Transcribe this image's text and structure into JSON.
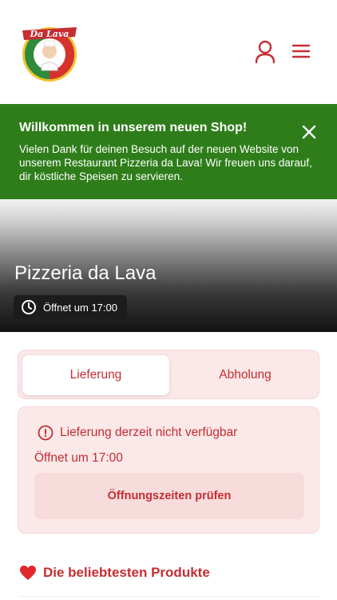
{
  "header": {
    "logo_text": "Da Lava",
    "user_icon": "user-icon",
    "menu_icon": "menu-icon"
  },
  "banner": {
    "title": "Willkommen in unserem neuen Shop!",
    "text": "Vielen Dank für deinen Besuch auf der neuen Website von unserem Restaurant Pizzeria da Lava! Wir freuen uns darauf, dir köstliche Speisen zu servieren.",
    "close_icon": "close-icon",
    "color": "#2e7d1a"
  },
  "hero": {
    "title": "Pizzeria da Lava",
    "open_status": "Öffnet um 17:00",
    "clock_icon": "clock-icon"
  },
  "order_mode": {
    "options": [
      {
        "label": "Lieferung",
        "selected": true
      },
      {
        "label": "Abholung",
        "selected": false
      }
    ]
  },
  "notice": {
    "message": "Lieferung derzeit nicht verfügbar",
    "opens": "Öffnet um 17:00",
    "button": "Öffnungszeiten prüfen",
    "info_icon": "info-icon"
  },
  "popular": {
    "title": "Die beliebtesten Produkte",
    "heart_icon": "heart-icon"
  },
  "colors": {
    "accent": "#c62d32",
    "soft_background": "#fbe8e8"
  }
}
